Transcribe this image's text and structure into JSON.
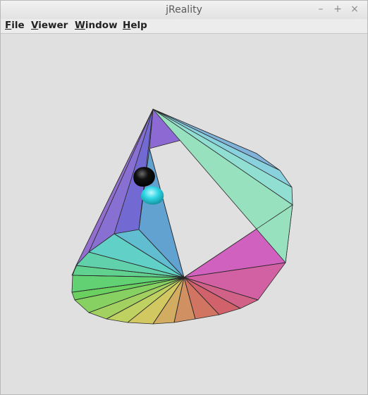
{
  "window": {
    "title": "jReality",
    "controls": {
      "minimize": "–",
      "maximize": "+",
      "close": "×"
    }
  },
  "menubar": {
    "items": [
      {
        "mnemonic": "F",
        "rest": "ile"
      },
      {
        "mnemonic": "V",
        "rest": "iewer"
      },
      {
        "mnemonic": "W",
        "rest": "indow"
      },
      {
        "mnemonic": "H",
        "rest": "elp"
      }
    ]
  },
  "colors": {
    "background": "#e0e0e0",
    "sphere_black": "#000000",
    "sphere_cyan": "#2fd6e4"
  }
}
